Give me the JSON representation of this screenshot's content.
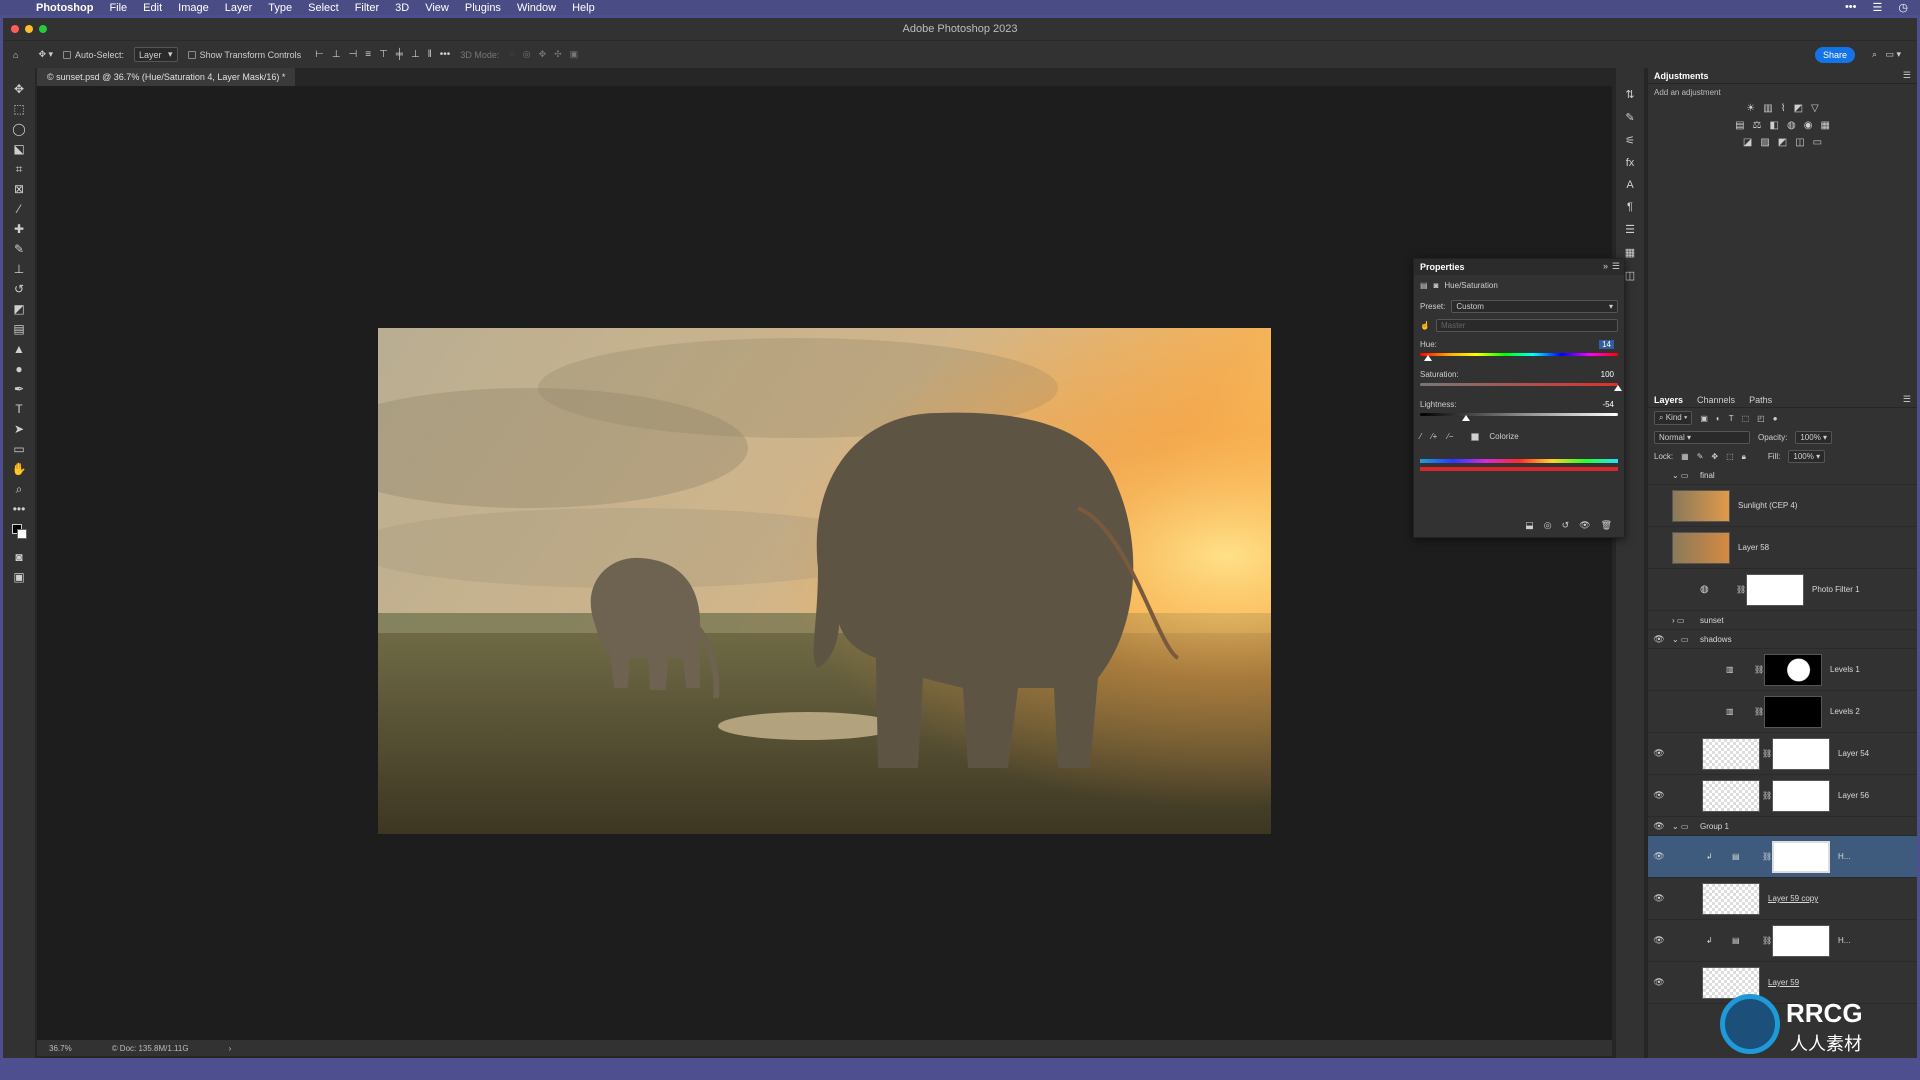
{
  "menubar": {
    "items": [
      "Photoshop",
      "File",
      "Edit",
      "Image",
      "Layer",
      "Type",
      "Select",
      "Filter",
      "3D",
      "View",
      "Plugins",
      "Window",
      "Help"
    ]
  },
  "window": {
    "title": "Adobe Photoshop 2023"
  },
  "options_bar": {
    "auto_select_label": "Auto-Select:",
    "auto_select_value": "Layer",
    "show_transform_label": "Show Transform Controls",
    "mode_3d_label": "3D Mode:",
    "share_label": "Share"
  },
  "document_tab": {
    "title": "© sunset.psd @ 36.7% (Hue/Saturation 4, Layer Mask/16) *"
  },
  "status": {
    "zoom": "36.7%",
    "doc": "© Doc: 135.8M/1.11G"
  },
  "adjustments": {
    "title": "Adjustments",
    "subtitle": "Add an adjustment"
  },
  "properties": {
    "title": "Properties",
    "subtitle": "Hue/Saturation",
    "preset_label": "Preset:",
    "preset_value": "Custom",
    "channel_value": "Master",
    "hue_label": "Hue:",
    "hue_value": "14",
    "hue_fraction": 0.04,
    "saturation_label": "Saturation:",
    "saturation_value": "100",
    "saturation_fraction": 1.0,
    "lightness_label": "Lightness:",
    "lightness_value": "-54",
    "lightness_fraction": 0.23,
    "colorize_label": "Colorize"
  },
  "layers_panel": {
    "tabs": [
      "Layers",
      "Channels",
      "Paths"
    ],
    "kind_label": "Kind",
    "blend_mode": "Normal",
    "opacity_label": "Opacity:",
    "opacity_value": "100%",
    "lock_label": "Lock:",
    "fill_label": "Fill:",
    "fill_value": "100%",
    "layers": [
      {
        "name": "final",
        "type": "group",
        "visible": false
      },
      {
        "name": "Sunlight (CEP 4)",
        "type": "image",
        "visible": false
      },
      {
        "name": "Layer 58",
        "type": "image",
        "visible": false
      },
      {
        "name": "Photo Filter 1",
        "type": "adjustment",
        "visible": false
      },
      {
        "name": "sunset",
        "type": "group",
        "visible": false
      },
      {
        "name": "shadows",
        "type": "group",
        "visible": true
      },
      {
        "name": "Levels 1",
        "type": "adjustment",
        "visible": false
      },
      {
        "name": "Levels 2",
        "type": "adjustment",
        "visible": false
      },
      {
        "name": "Layer 54",
        "type": "image",
        "visible": true
      },
      {
        "name": "Layer 56",
        "type": "image",
        "visible": true
      },
      {
        "name": "Group 1",
        "type": "group",
        "visible": true
      },
      {
        "name": "H...",
        "type": "adjustment",
        "visible": true,
        "selected": true
      },
      {
        "name": "Layer 59 copy",
        "type": "image",
        "visible": true
      },
      {
        "name": "H...",
        "type": "adjustment",
        "visible": true
      },
      {
        "name": "Layer 59",
        "type": "image",
        "visible": true
      }
    ]
  },
  "watermark": {
    "text": "RRCG",
    "subtext": "人人素材"
  }
}
